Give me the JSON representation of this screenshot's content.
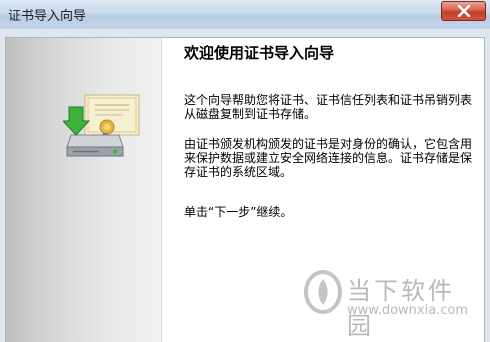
{
  "window": {
    "title": "证书导入向导"
  },
  "wizard": {
    "heading": "欢迎使用证书导入向导",
    "paragraph_1": "这个向导帮助您将证书、证书信任列表和证书吊销列表从磁盘复制到证书存储。",
    "paragraph_2": "由证书颁发机构颁发的证书是对身份的确认，它包含用来保护数据或建立安全网络连接的信息。证书存储是保存证书的系统区域。",
    "paragraph_3": "单击“下一步”继续。"
  },
  "watermark": {
    "name": "当下软件园",
    "url": "www.downxia.com"
  },
  "icons": {
    "close": "close-icon",
    "certificate": "certificate-import-icon",
    "logo": "downxia-logo-icon"
  },
  "colors": {
    "titlebar": "#c8d9ec",
    "close_button": "#c23d28",
    "watermark": "#b9b9b9"
  }
}
